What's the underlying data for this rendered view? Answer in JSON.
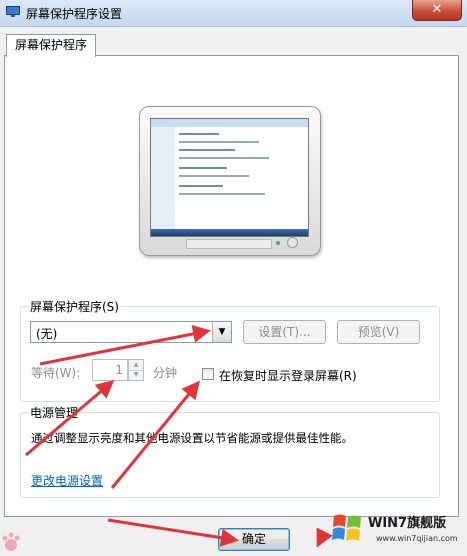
{
  "window": {
    "title": "屏幕保护程序设置",
    "close_label": "✕"
  },
  "tab": {
    "label": "屏幕保护程序"
  },
  "screensaver": {
    "group_label": "屏幕保护程序(S)",
    "selected": "(无)",
    "settings_button": "设置(T)...",
    "preview_button": "预览(V)",
    "wait_label": "等待(W):",
    "wait_value": "1",
    "wait_unit": "分钟",
    "resume_checkbox_label": "在恢复时显示登录屏幕(R)",
    "resume_checked": false
  },
  "power": {
    "group_label": "电源管理",
    "description": "通过调整显示亮度和其他电源设置以节省能源或提供最佳性能。",
    "link": "更改电源设置"
  },
  "footer": {
    "ok_button": "确定"
  },
  "watermark": {
    "title": "WIN7旗舰版",
    "url": "www.win7qijian.com"
  },
  "colors": {
    "annotation_arrow": "#e0333a",
    "link": "#0066cc",
    "close_button": "#c7503a"
  }
}
